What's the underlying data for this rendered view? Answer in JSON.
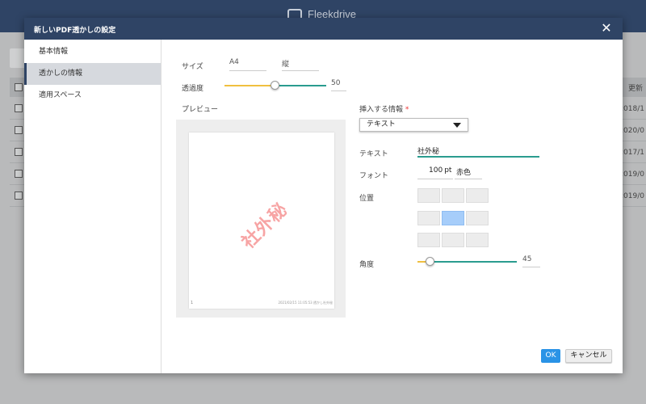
{
  "app": {
    "logo_text": "Fleekdrive"
  },
  "background": {
    "column_header": "更新",
    "rows": [
      {
        "date": "2018/1"
      },
      {
        "date": "2020/0"
      },
      {
        "date": "2017/1"
      },
      {
        "date": "2019/0"
      },
      {
        "date": "2019/0"
      }
    ]
  },
  "modal": {
    "title": "新しいPDF透かしの設定",
    "close_symbol": "✕"
  },
  "sidebar": {
    "items": [
      {
        "label": "基本情報",
        "active": false
      },
      {
        "label": "透かしの情報",
        "active": true
      },
      {
        "label": "適用スペース",
        "active": false
      }
    ]
  },
  "settings": {
    "size_label": "サイズ",
    "size_value": "A4",
    "orientation_value": "縦",
    "opacity_label": "透過度",
    "opacity_value": "50",
    "preview_label": "プレビュー",
    "preview_page_number": "1",
    "preview_footer": "2021/02/15 11:05:53  透かし社外秘"
  },
  "insert": {
    "label": "挿入する情報",
    "required_mark": "*",
    "type_selected": "テキスト",
    "text_label": "テキスト",
    "text_value": "社外秘",
    "font_label": "フォント",
    "font_size": "100",
    "font_unit": "pt",
    "font_color": "赤色",
    "position_label": "位置",
    "position_selected": "middle-center",
    "angle_label": "角度",
    "angle_value": "45"
  },
  "watermark_preview_text": "社外秘",
  "buttons": {
    "ok": "OK",
    "cancel": "キャンセル"
  },
  "colors": {
    "header": "#2f4465",
    "accent_teal": "#2a9c8f",
    "accent_yellow": "#f0c040",
    "ok_button": "#2a93e6",
    "position_selected": "#a6cdfa",
    "watermark": "#f05a5a"
  }
}
